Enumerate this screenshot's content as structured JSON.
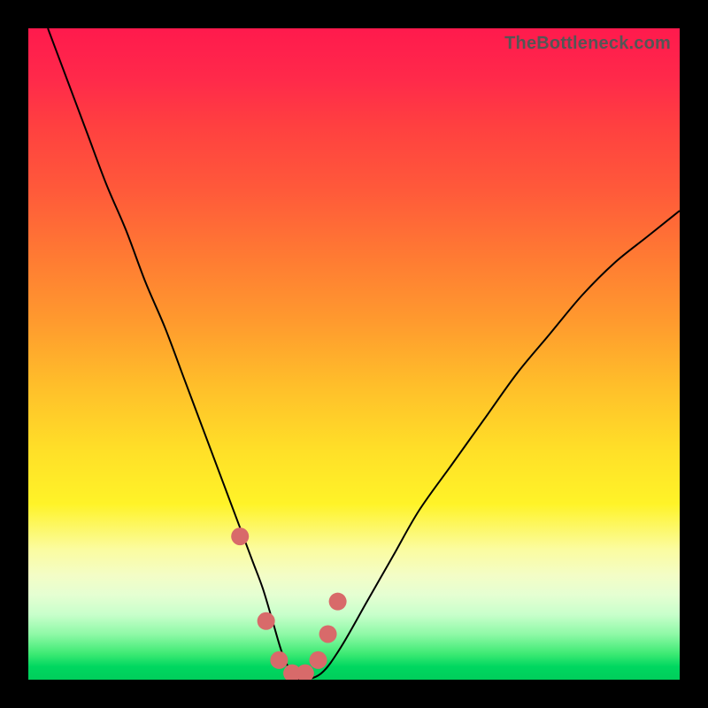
{
  "watermark": {
    "text": "TheBottleneck.com"
  },
  "chart_data": {
    "type": "line",
    "title": "",
    "xlabel": "",
    "ylabel": "",
    "xlim": [
      0,
      100
    ],
    "ylim": [
      0,
      100
    ],
    "series": [
      {
        "name": "bottleneck-curve",
        "x": [
          3,
          6,
          9,
          12,
          15,
          18,
          21,
          24,
          27,
          30,
          33,
          34.5,
          36,
          37.5,
          39,
          40.5,
          42,
          45,
          48,
          52,
          56,
          60,
          65,
          70,
          75,
          80,
          85,
          90,
          95,
          100
        ],
        "values": [
          100,
          92,
          84,
          76,
          69,
          61,
          54,
          46,
          38,
          30,
          22,
          18,
          14,
          9,
          4,
          1,
          0,
          1,
          5,
          12,
          19,
          26,
          33,
          40,
          47,
          53,
          59,
          64,
          68,
          72
        ]
      }
    ],
    "markers": {
      "name": "highlight-markers",
      "x": [
        32.5,
        36.5,
        38.5,
        40.5,
        42.5,
        44.5,
        46,
        47.5
      ],
      "values": [
        22,
        9,
        3,
        1,
        1,
        3,
        7,
        12
      ],
      "radius": [
        10,
        10,
        10,
        10,
        10,
        10,
        10,
        10
      ]
    },
    "marker_color": "#d86a6a",
    "curve_color": "#000000",
    "curve_width": 2
  }
}
